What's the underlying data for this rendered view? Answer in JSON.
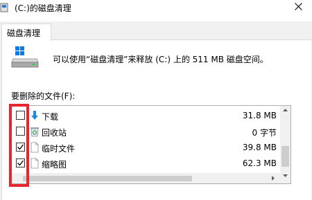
{
  "window": {
    "title": "(C:)的磁盘清理",
    "close_icon": "close-icon"
  },
  "tabs": [
    {
      "label": "磁盘清理"
    }
  ],
  "summary": {
    "text": "可以使用“磁盘清理”来释放  (C:) 上的 511 MB 磁盘空间。"
  },
  "files_section": {
    "label": "要删除的文件(F):"
  },
  "file_list": [
    {
      "name": "下载",
      "size": "31.8 MB",
      "checked": false,
      "icon": "download-icon"
    },
    {
      "name": "回收站",
      "size": "0 字节",
      "checked": false,
      "icon": "recycle-bin-icon"
    },
    {
      "name": "临时文件",
      "size": "39.8 MB",
      "checked": true,
      "icon": "file-icon"
    },
    {
      "name": "缩略图",
      "size": "62.3 MB",
      "checked": true,
      "icon": "file-icon"
    }
  ],
  "colors": {
    "highlight": "#e8262d",
    "accent": "#1e88e5",
    "window_bg": "#f0f0f0"
  }
}
